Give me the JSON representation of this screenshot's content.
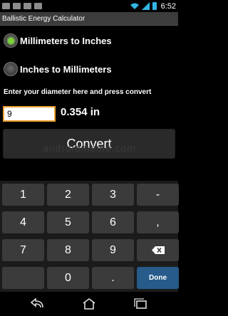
{
  "status_bar": {
    "time": "6:52",
    "notification_icons": [
      "envelope-icon",
      "image-icon",
      "mail-icon",
      "image-icon"
    ]
  },
  "app": {
    "title": "Ballistic Energy Calculator"
  },
  "options": [
    {
      "label": "Millimeters to Inches",
      "selected": true
    },
    {
      "label": "Inches to Millimeters",
      "selected": false
    }
  ],
  "prompt": "Enter your diameter here and press convert",
  "input": {
    "value": "9"
  },
  "result": "0.354 in",
  "convert_label": "Convert",
  "watermark": "androidmeme.com",
  "keyboard": {
    "rows": [
      [
        "1",
        "2",
        "3",
        "-"
      ],
      [
        "4",
        "5",
        "6",
        ","
      ],
      [
        "7",
        "8",
        "9",
        "backspace"
      ],
      [
        "",
        "0",
        ".",
        "Done"
      ]
    ],
    "accent": "#265b8a"
  },
  "nav_bar": {
    "icons": [
      "back-icon",
      "home-icon",
      "recent-apps-icon"
    ]
  }
}
